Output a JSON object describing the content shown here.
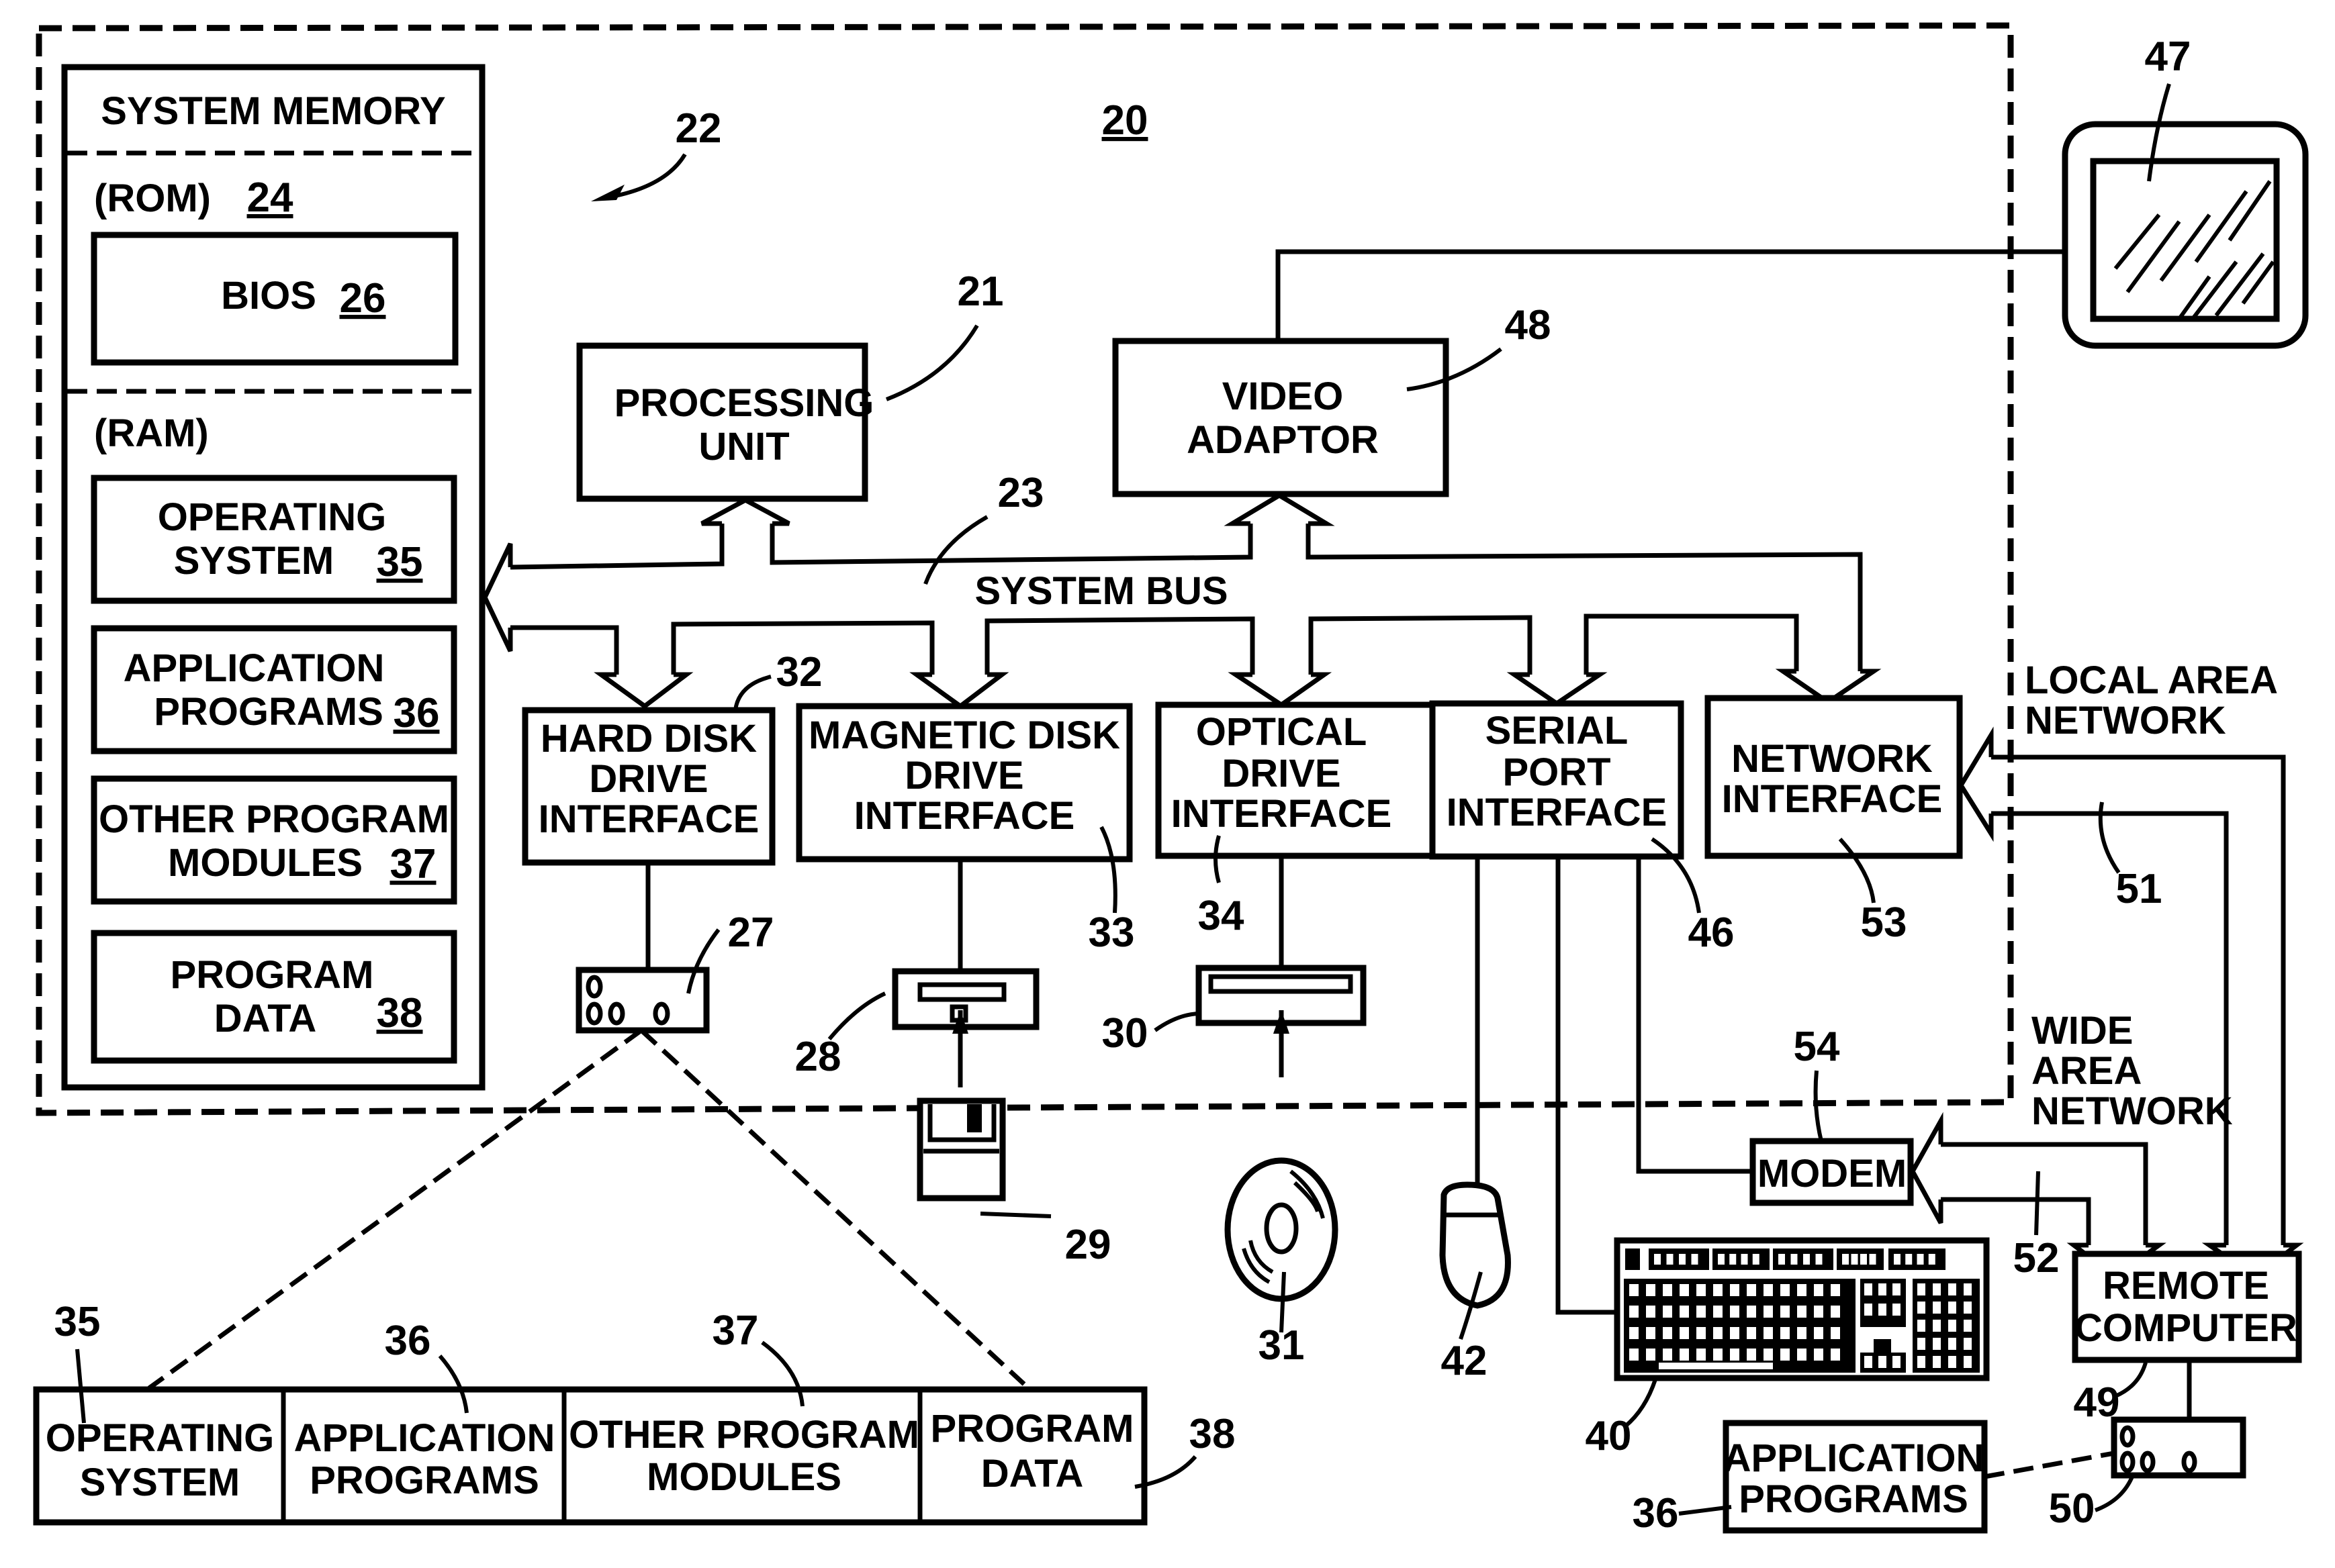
{
  "figure": {
    "computer_ref": "20",
    "system_memory_ref": "22",
    "system_bus_ref": "23"
  },
  "system_memory": {
    "title": "SYSTEM MEMORY",
    "rom_label": "(ROM)",
    "rom_ref": "24",
    "bios_label": "BIOS",
    "bios_ref": "26",
    "ram_label": "(RAM)",
    "ram_items": [
      {
        "line1": "OPERATING",
        "line2": "SYSTEM",
        "ref": "35"
      },
      {
        "line1": "APPLICATION",
        "line2": "PROGRAMS",
        "ref": "36"
      },
      {
        "line1": "OTHER PROGRAM",
        "line2": "MODULES",
        "ref": "37"
      },
      {
        "line1": "PROGRAM",
        "line2": "DATA",
        "ref": "38"
      }
    ]
  },
  "processing_unit": {
    "line1": "PROCESSING",
    "line2": "UNIT",
    "ref": "21"
  },
  "video_adaptor": {
    "line1": "VIDEO",
    "line2": "ADAPTOR",
    "ref": "48"
  },
  "monitor": {
    "ref": "47"
  },
  "system_bus": {
    "label": "SYSTEM BUS"
  },
  "interfaces": [
    {
      "line1": "HARD DISK",
      "line2": "DRIVE",
      "line3": "INTERFACE",
      "ref": "32"
    },
    {
      "line1": "MAGNETIC DISK",
      "line2": "DRIVE",
      "line3": "INTERFACE",
      "ref": "33"
    },
    {
      "line1": "OPTICAL",
      "line2": "DRIVE",
      "line3": "INTERFACE",
      "ref": "34"
    },
    {
      "line1": "SERIAL",
      "line2": "PORT",
      "line3": "INTERFACE",
      "ref": "46"
    },
    {
      "line1": "NETWORK",
      "line2": "INTERFACE",
      "line3": "",
      "ref": "53"
    }
  ],
  "devices": {
    "hard_disk_ref": "27",
    "floppy_drive_ref": "28",
    "floppy_disk_ref": "29",
    "optical_drive_ref": "30",
    "optical_disk_ref": "31",
    "mouse_ref": "42",
    "keyboard_ref": "40"
  },
  "networks": {
    "lan_line1": "LOCAL AREA",
    "lan_line2": "NETWORK",
    "lan_ref": "51",
    "wan_line1": "WIDE",
    "wan_line2": "AREA",
    "wan_line3": "NETWORK",
    "wan_ref": "52"
  },
  "modem": {
    "label": "MODEM",
    "ref": "54"
  },
  "remote_computer": {
    "line1": "REMOTE",
    "line2": "COMPUTER",
    "ref": "49"
  },
  "remote_storage": {
    "ref": "50"
  },
  "remote_apps": {
    "line1": "APPLICATION",
    "line2": "PROGRAMS",
    "ref": "36"
  },
  "hard_disk_contents": [
    {
      "line1": "OPERATING",
      "line2": "SYSTEM",
      "ref": "35"
    },
    {
      "line1": "APPLICATION",
      "line2": "PROGRAMS",
      "ref": "36"
    },
    {
      "line1": "OTHER PROGRAM",
      "line2": "MODULES",
      "ref": "37"
    },
    {
      "line1": "PROGRAM",
      "line2": "DATA",
      "ref": "38"
    }
  ]
}
